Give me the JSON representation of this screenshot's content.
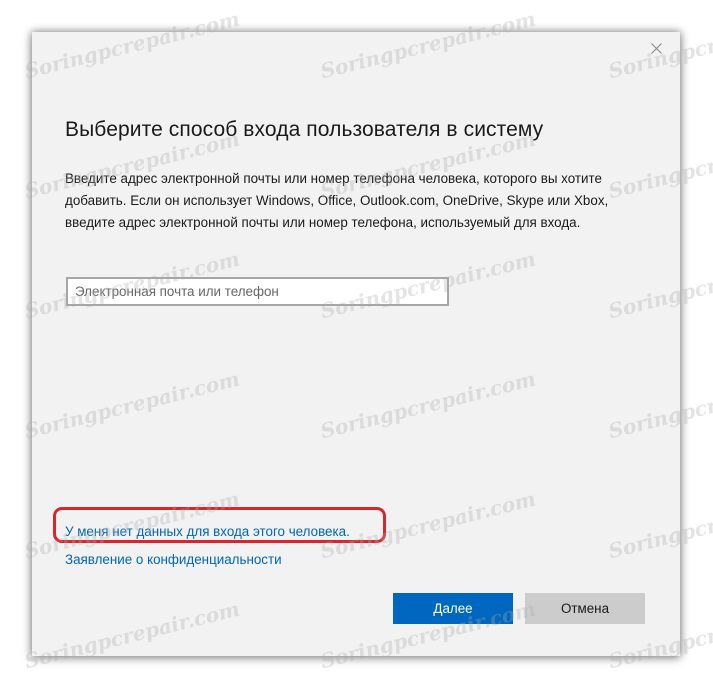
{
  "dialog": {
    "close_icon": "close-icon",
    "title": "Выберите способ входа пользователя в систему",
    "description": "Введите адрес электронной почты или номер телефона человека, которого вы хотите добавить. Если он использует Windows, Office, Outlook.com, OneDrive, Skype или Xbox, введите адрес электронной почты или номер телефона, используемый для входа.",
    "email_input": {
      "value": "",
      "placeholder": "Электронная почта или телефон"
    },
    "links": {
      "no_signin_info": "У меня нет данных для входа этого человека.",
      "privacy": "Заявление о конфиденциальности"
    },
    "buttons": {
      "next": "Далее",
      "cancel": "Отмена"
    }
  },
  "watermark": "Soringpcrepair.com",
  "colors": {
    "dialog_bg": "#f2f2f2",
    "accent": "#0067c0",
    "link": "#0066b4",
    "cancel_bg": "#cccccc",
    "highlight": "#d9262b"
  }
}
